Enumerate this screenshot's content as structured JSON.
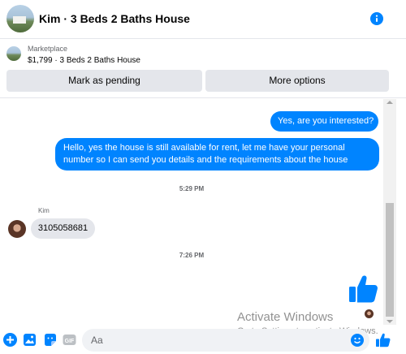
{
  "header": {
    "title": "Kim · 3 Beds 2 Baths House",
    "info_icon": "info-icon"
  },
  "marketplace": {
    "label": "Marketplace",
    "listing": "$1,799 · 3 Beds 2 Baths House",
    "buttons": {
      "mark_pending": "Mark as pending",
      "more_options": "More options"
    }
  },
  "messages": {
    "outgoing_1": "Yes, are you interested?",
    "outgoing_2": "Hello, yes the house is still available for rent, let me have your personal number so I can send you details and the requirements about the house",
    "timestamp_1": "5:29 PM",
    "sender_name": "Kim",
    "incoming_1": "3105058681",
    "timestamp_2": "7:26 PM",
    "last_outgoing": "thumbs-up-like"
  },
  "watermark": {
    "line1": "Activate Windows",
    "line2": "Go to Settings to activate Windows."
  },
  "composer": {
    "placeholder": "Aa",
    "value": "",
    "icons": [
      "plus-icon",
      "image-icon",
      "sticker-icon",
      "gif-icon",
      "emoji-icon",
      "like-icon"
    ]
  },
  "colors": {
    "accent": "#0084ff",
    "incoming_bubble": "#e4e6eb",
    "secondary_text": "#65676b"
  }
}
